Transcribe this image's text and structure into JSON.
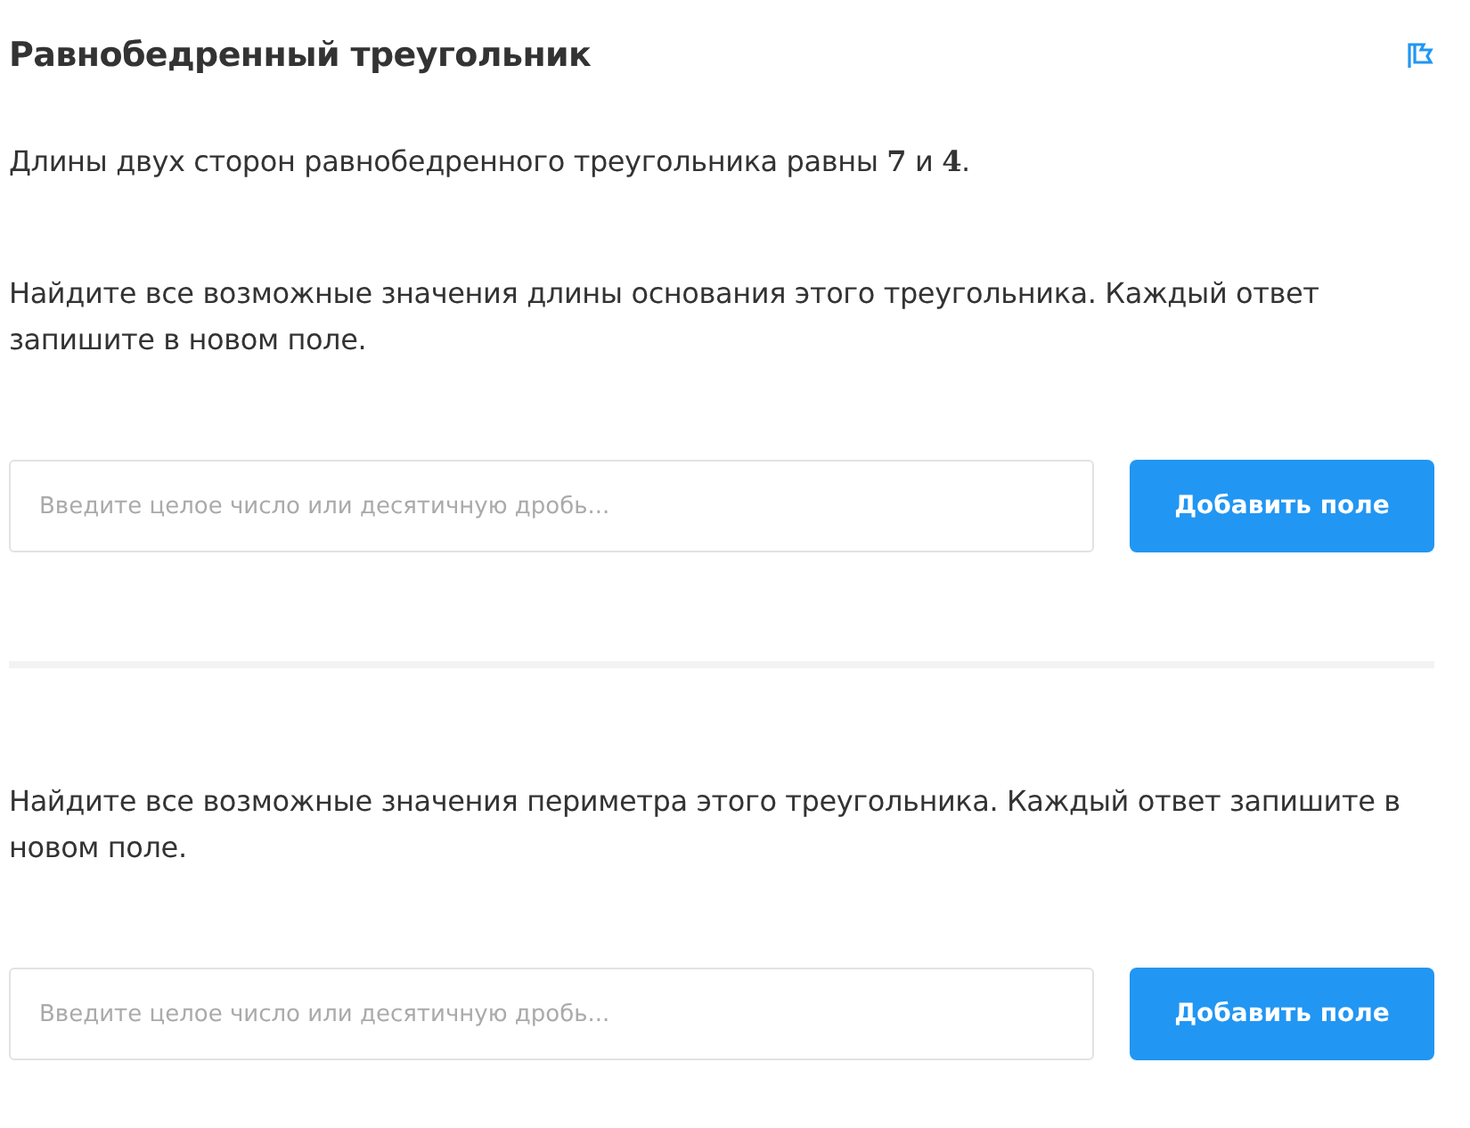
{
  "title": "Равнобедренный треугольник",
  "intro": "Длины двух сторон равнобедренного треугольника равны **7** и **4**.",
  "questions": [
    {
      "text": "Найдите все возможные значения длины основания этого треугольника. Каждый ответ запишите в новом поле.",
      "placeholder": "Введите целое число или десятичную дробь...",
      "button": "Добавить поле"
    },
    {
      "text": "Найдите все возможные значения периметра этого треугольника. Каждый ответ запишите в новом поле.",
      "placeholder": "Введите целое число или десятичную дробь...",
      "button": "Добавить поле"
    }
  ]
}
